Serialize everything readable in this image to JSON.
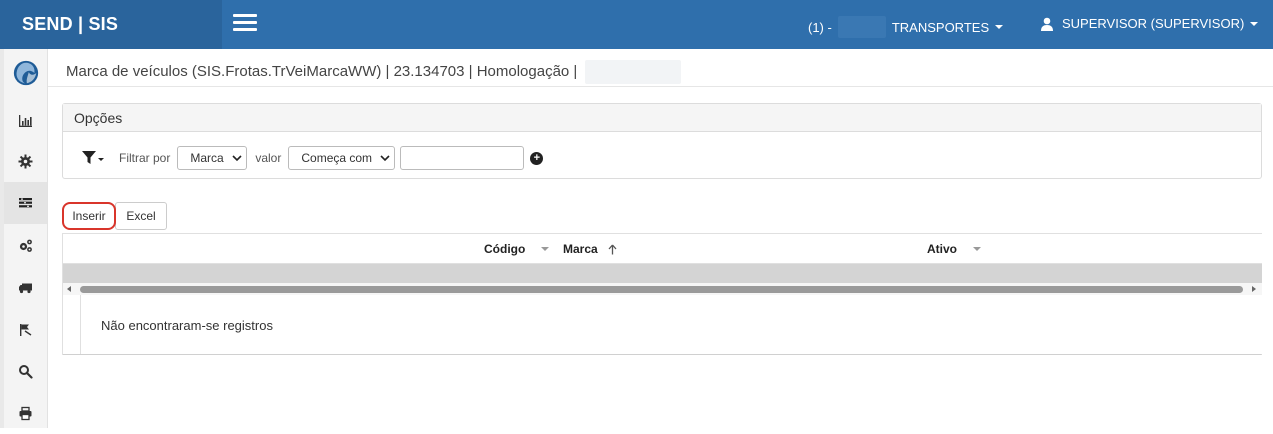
{
  "header": {
    "brand": "SEND | SIS",
    "company_prefix": "(1) -",
    "company_name": "TRANSPORTES",
    "user_label": "SUPERVISOR (SUPERVISOR)"
  },
  "sidebar": {
    "items": [
      {
        "icon": "logo-icon"
      },
      {
        "icon": "bar-chart-icon"
      },
      {
        "icon": "gear-icon"
      },
      {
        "icon": "list-icon",
        "active": true
      },
      {
        "icon": "gears-icon"
      },
      {
        "icon": "truck-icon"
      },
      {
        "icon": "flag-icon"
      },
      {
        "icon": "search-icon"
      },
      {
        "icon": "print-icon"
      }
    ]
  },
  "page": {
    "title": "Marca de veículos (SIS.Frotas.TrVeiMarcaWW) | 23.134703 | Homologação |"
  },
  "options": {
    "title": "Opções",
    "filter_by_label": "Filtrar por",
    "field_value": "Marca",
    "value_label": "valor",
    "operator_value": "Começa com",
    "input_value": ""
  },
  "actions": {
    "insert_label": "Inserir",
    "excel_label": "Excel"
  },
  "grid": {
    "columns": [
      "Código",
      "Marca",
      "Ativo"
    ],
    "sorted_column": "Marca",
    "sort_direction": "ascending",
    "empty_message": "Não encontraram-se registros"
  },
  "colors": {
    "navbar": "#2f6fac",
    "brand_bg": "#2a649c",
    "highlight": "#d9352b"
  }
}
